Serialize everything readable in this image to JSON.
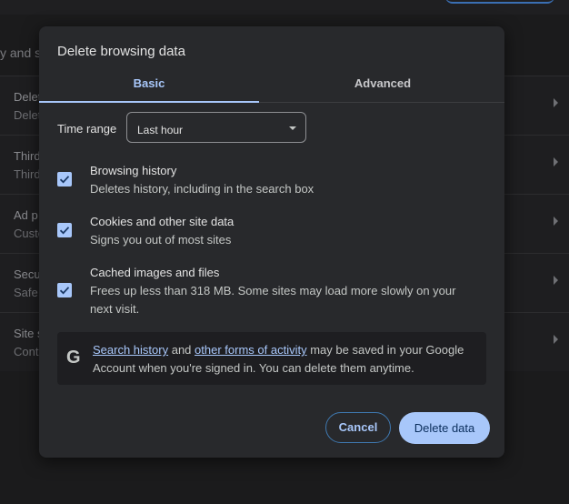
{
  "background": {
    "section_title": "y and s",
    "rows": [
      {
        "line1": "Delet",
        "line2": "Delet"
      },
      {
        "line1": "Third",
        "line2": "Third"
      },
      {
        "line1": "Ad p",
        "line2": "Custo"
      },
      {
        "line1": "Secu",
        "line2": "Safe"
      },
      {
        "line1": "Site s",
        "line2": "Cont"
      }
    ]
  },
  "dialog": {
    "title": "Delete browsing data",
    "tabs": {
      "basic": "Basic",
      "advanced": "Advanced"
    },
    "time_range": {
      "label": "Time range",
      "value": "Last hour"
    },
    "options": [
      {
        "title": "Browsing history",
        "desc": "Deletes history, including in the search box",
        "checked": true
      },
      {
        "title": "Cookies and other site data",
        "desc": "Signs you out of most sites",
        "checked": true
      },
      {
        "title": "Cached images and files",
        "desc": "Frees up less than 318 MB. Some sites may load more slowly on your next visit.",
        "checked": true
      }
    ],
    "info": {
      "icon": "G",
      "link1": "Search history",
      "and": "and",
      "link2": "other forms of activity",
      "rest": "may be saved in your Google Account when you're signed in. You can delete them anytime."
    },
    "buttons": {
      "cancel": "Cancel",
      "delete": "Delete data"
    },
    "colors": {
      "accent": "#a8c7fa",
      "surface": "#28292c"
    }
  }
}
